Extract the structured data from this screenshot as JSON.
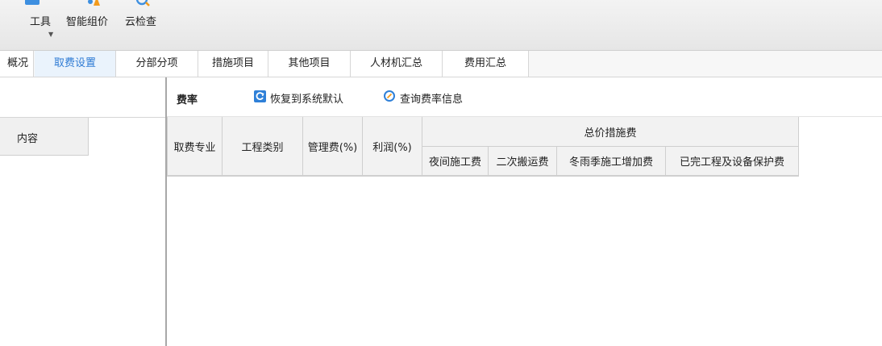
{
  "ribbon": {
    "tools_label": "工具",
    "smart_price_label": "智能组价",
    "cloud_check_label": "云检查"
  },
  "tabs": [
    "概况",
    "取费设置",
    "分部分项",
    "措施项目",
    "其他项目",
    "人材机汇总",
    "费用汇总"
  ],
  "active_tab": "取费设置",
  "left_panel": {
    "content_tab": "内容"
  },
  "toolbar": {
    "title": "费率",
    "restore_label": "恢复到系统默认",
    "query_label": "查询费率信息"
  },
  "table": {
    "columns": [
      "取费专业",
      "工程类别",
      "管理费(%)",
      "利润(%)"
    ],
    "group_header": "总价措施费",
    "sub_columns": [
      "夜间施工费",
      "二次搬运费",
      "冬雨季施工增加费",
      "已完工程及设备保护费"
    ],
    "rows": []
  },
  "colors": {
    "accent": "#2e7bd4",
    "active_tab_bg": "#eaf3fc"
  }
}
